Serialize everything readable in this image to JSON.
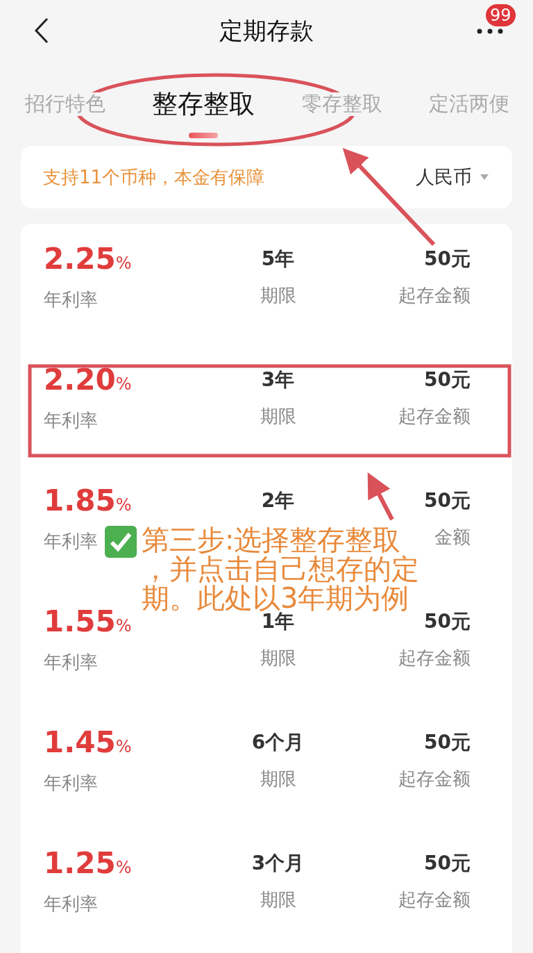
{
  "header": {
    "title": "定期存款",
    "badge": "99"
  },
  "tabs": [
    {
      "label": "招行特色",
      "selected": false
    },
    {
      "label": "整存整取",
      "selected": true
    },
    {
      "label": "零存整取",
      "selected": false
    },
    {
      "label": "定活两便",
      "selected": false
    }
  ],
  "info": {
    "text": "支持11个币种，本金有保障",
    "currency": "人民币"
  },
  "rows": [
    {
      "rate": "2.25",
      "unit": "%",
      "rate_label": "年利率",
      "term": "5年",
      "term_label": "期限",
      "min": "50元",
      "min_label": "起存金额"
    },
    {
      "rate": "2.20",
      "unit": "%",
      "rate_label": "年利率",
      "term": "3年",
      "term_label": "期限",
      "min": "50元",
      "min_label": "起存金额"
    },
    {
      "rate": "1.85",
      "unit": "%",
      "rate_label": "年利率",
      "term": "2年",
      "min": "50元",
      "min_label": "金额"
    },
    {
      "rate": "1.55",
      "unit": "%",
      "rate_label": "年利率",
      "term": "1年",
      "term_label": "期限",
      "min": "50元",
      "min_label": "起存金额"
    },
    {
      "rate": "1.45",
      "unit": "%",
      "rate_label": "年利率",
      "term": "6个月",
      "term_label": "期限",
      "min": "50元",
      "min_label": "起存金额"
    },
    {
      "rate": "1.25",
      "unit": "%",
      "rate_label": "年利率",
      "term": "3个月",
      "term_label": "期限",
      "min": "50元",
      "min_label": "起存金额"
    }
  ],
  "annotation": {
    "text": "第三步:选择整存整取，并点击自己想存的定期。此处以3年期为例"
  }
}
